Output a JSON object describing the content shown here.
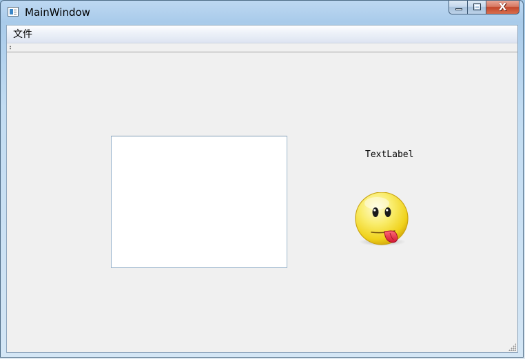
{
  "window": {
    "title": "MainWindow",
    "close_glyph": "X"
  },
  "menubar": {
    "items": [
      {
        "label": "文件"
      }
    ]
  },
  "central": {
    "text_label": "TextLabel",
    "text_edit_value": "",
    "emoji_icon": "tongue-out-smiley-icon"
  },
  "colors": {
    "face_yellow": "#f7e43a",
    "tongue_red": "#e8304a"
  }
}
